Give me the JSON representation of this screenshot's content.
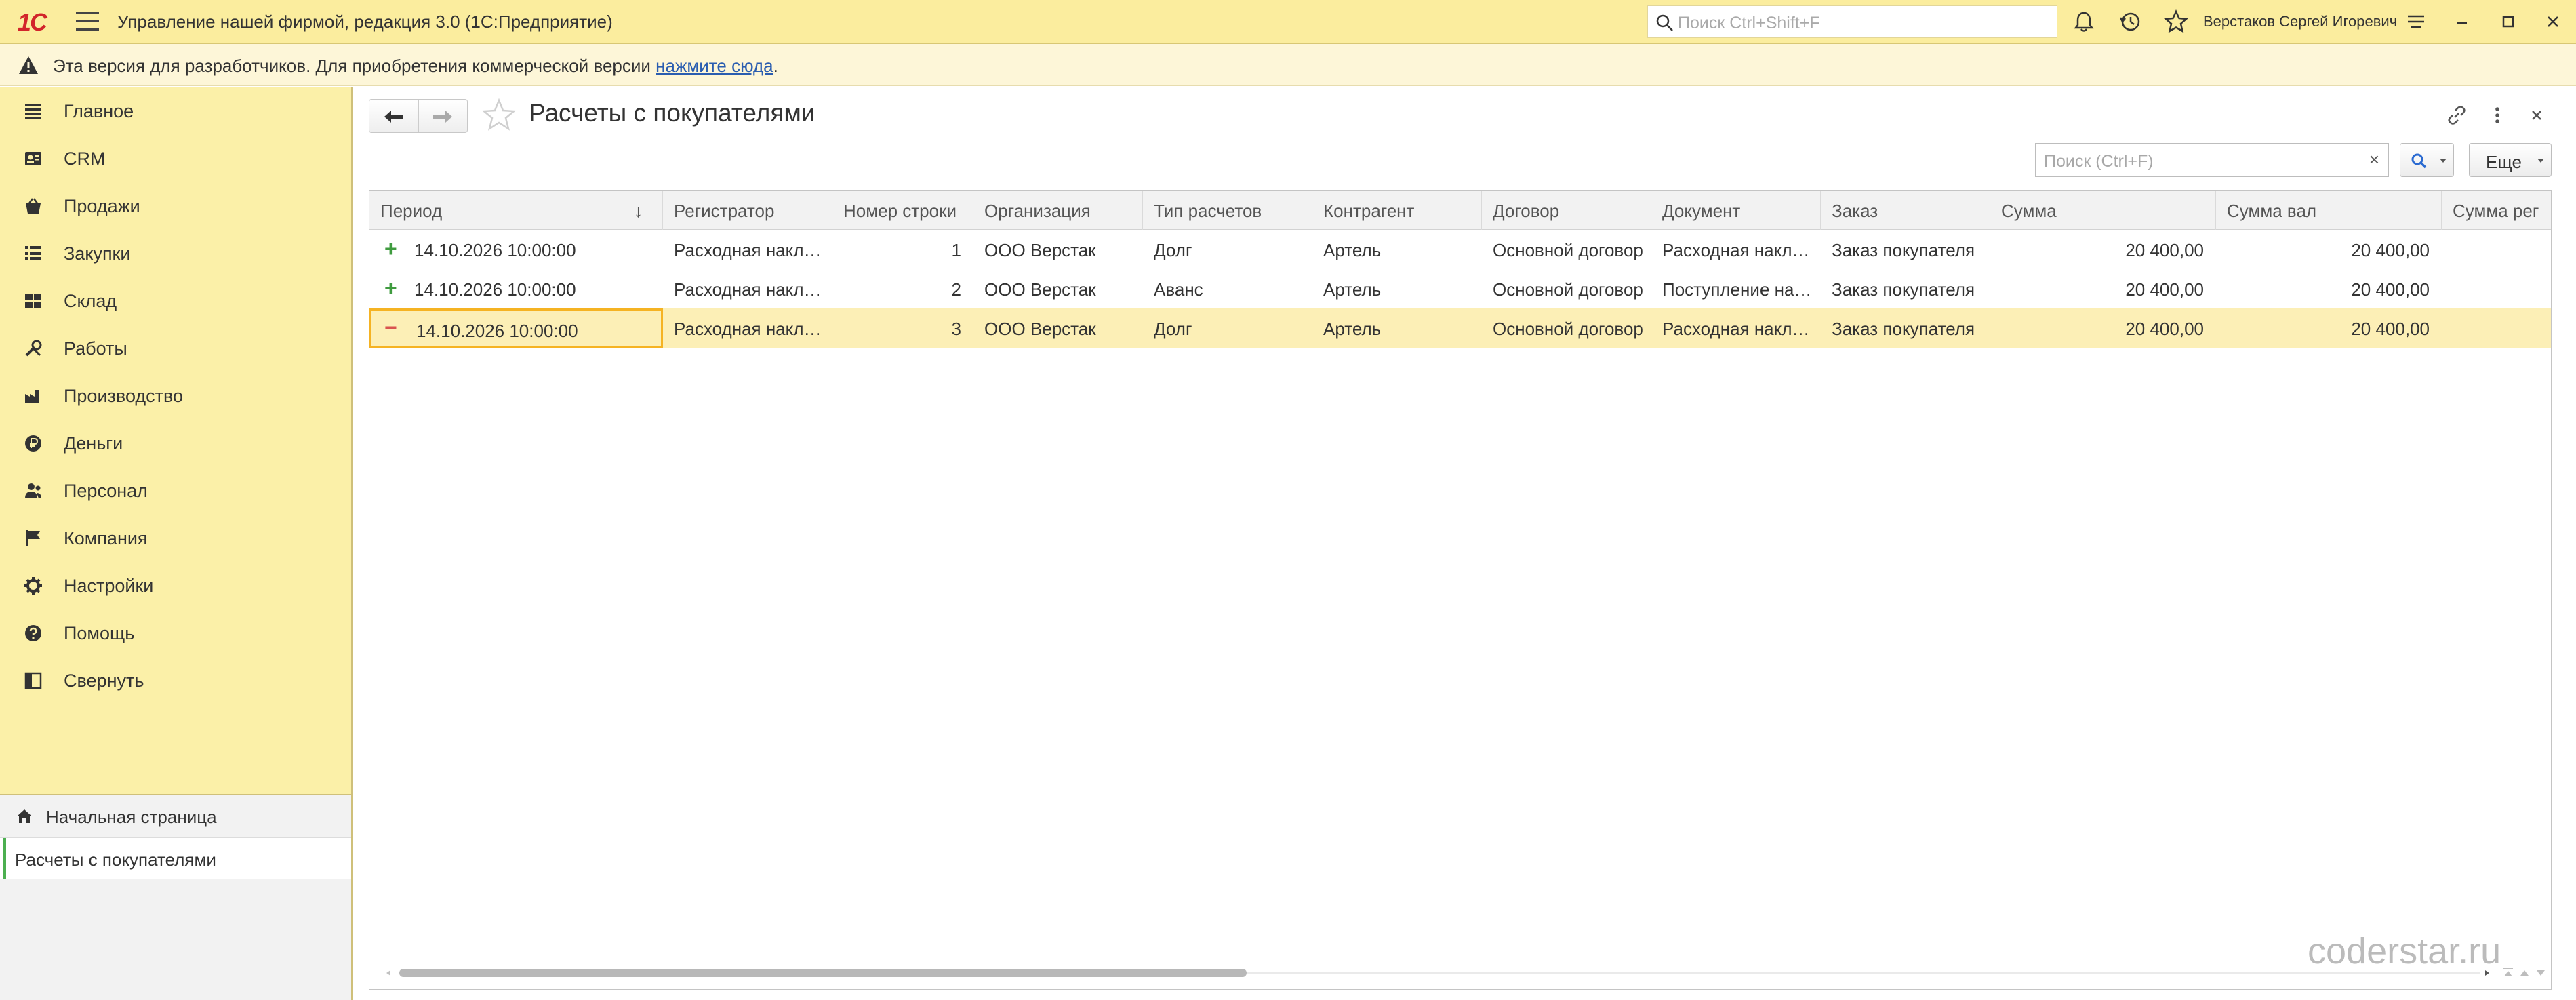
{
  "window": {
    "logo": "1С",
    "app_title": "Управление нашей фирмой, редакция 3.0  (1С:Предприятие)",
    "search_placeholder": "Поиск Ctrl+Shift+F",
    "user_name": "Верстаков Сергей Игоревич"
  },
  "dev_banner": {
    "message": "Эта версия для разработчиков. Для приобретения коммерческой версии ",
    "link": "нажмите сюда",
    "tail": "."
  },
  "sidebar": {
    "items": [
      {
        "label": "Главное",
        "icon": "list-icon"
      },
      {
        "label": "CRM",
        "icon": "crm-icon"
      },
      {
        "label": "Продажи",
        "icon": "basket-icon"
      },
      {
        "label": "Закупки",
        "icon": "purchase-icon"
      },
      {
        "label": "Склад",
        "icon": "warehouse-icon"
      },
      {
        "label": "Работы",
        "icon": "tools-icon"
      },
      {
        "label": "Производство",
        "icon": "factory-icon"
      },
      {
        "label": "Деньги",
        "icon": "ruble-icon"
      },
      {
        "label": "Персонал",
        "icon": "people-icon"
      },
      {
        "label": "Компания",
        "icon": "flag-icon"
      },
      {
        "label": "Настройки",
        "icon": "gear-icon"
      },
      {
        "label": "Помощь",
        "icon": "help-icon"
      },
      {
        "label": "Свернуть",
        "icon": "collapse-icon"
      }
    ],
    "open_tabs": [
      {
        "label": "Начальная страница",
        "icon": "home-icon"
      },
      {
        "label": "Расчеты с покупателями"
      }
    ]
  },
  "form": {
    "title": "Расчеты с покупателями",
    "search_placeholder": "Поиск (Ctrl+F)",
    "clear_label": "×",
    "more_label": "Еще"
  },
  "table": {
    "columns": [
      "Период",
      "Регистратор",
      "Номер строки",
      "Организация",
      "Тип расчетов",
      "Контрагент",
      "Договор",
      "Документ",
      "Заказ",
      "Сумма",
      "Сумма вал",
      "Сумма рег"
    ],
    "sort_indicator": "↓",
    "rows": [
      {
        "sign": "+",
        "period": "14.10.2026 10:00:00",
        "registrar": "Расходная накладная",
        "line_no": "1",
        "org": "ООО Верстак",
        "type": "Долг",
        "counterparty": "Артель",
        "contract": "Основной договор",
        "document": "Расходная накладная",
        "order": "Заказ покупателя",
        "sum": "20 400,00",
        "sum_cur": "20 400,00",
        "sum_reg": ""
      },
      {
        "sign": "+",
        "period": "14.10.2026 10:00:00",
        "registrar": "Расходная накладная",
        "line_no": "2",
        "org": "ООО Верстак",
        "type": "Аванс",
        "counterparty": "Артель",
        "contract": "Основной договор",
        "document": "Поступление на счет",
        "order": "Заказ покупателя",
        "sum": "20 400,00",
        "sum_cur": "20 400,00",
        "sum_reg": ""
      },
      {
        "sign": "−",
        "period": "14.10.2026 10:00:00",
        "registrar": "Расходная накладная",
        "line_no": "3",
        "org": "ООО Верстак",
        "type": "Долг",
        "counterparty": "Артель",
        "contract": "Основной договор",
        "document": "Расходная накладная",
        "order": "Заказ покупателя",
        "sum": "20 400,00",
        "sum_cur": "20 400,00",
        "sum_reg": ""
      }
    ]
  },
  "watermark": "coderstar.ru"
}
